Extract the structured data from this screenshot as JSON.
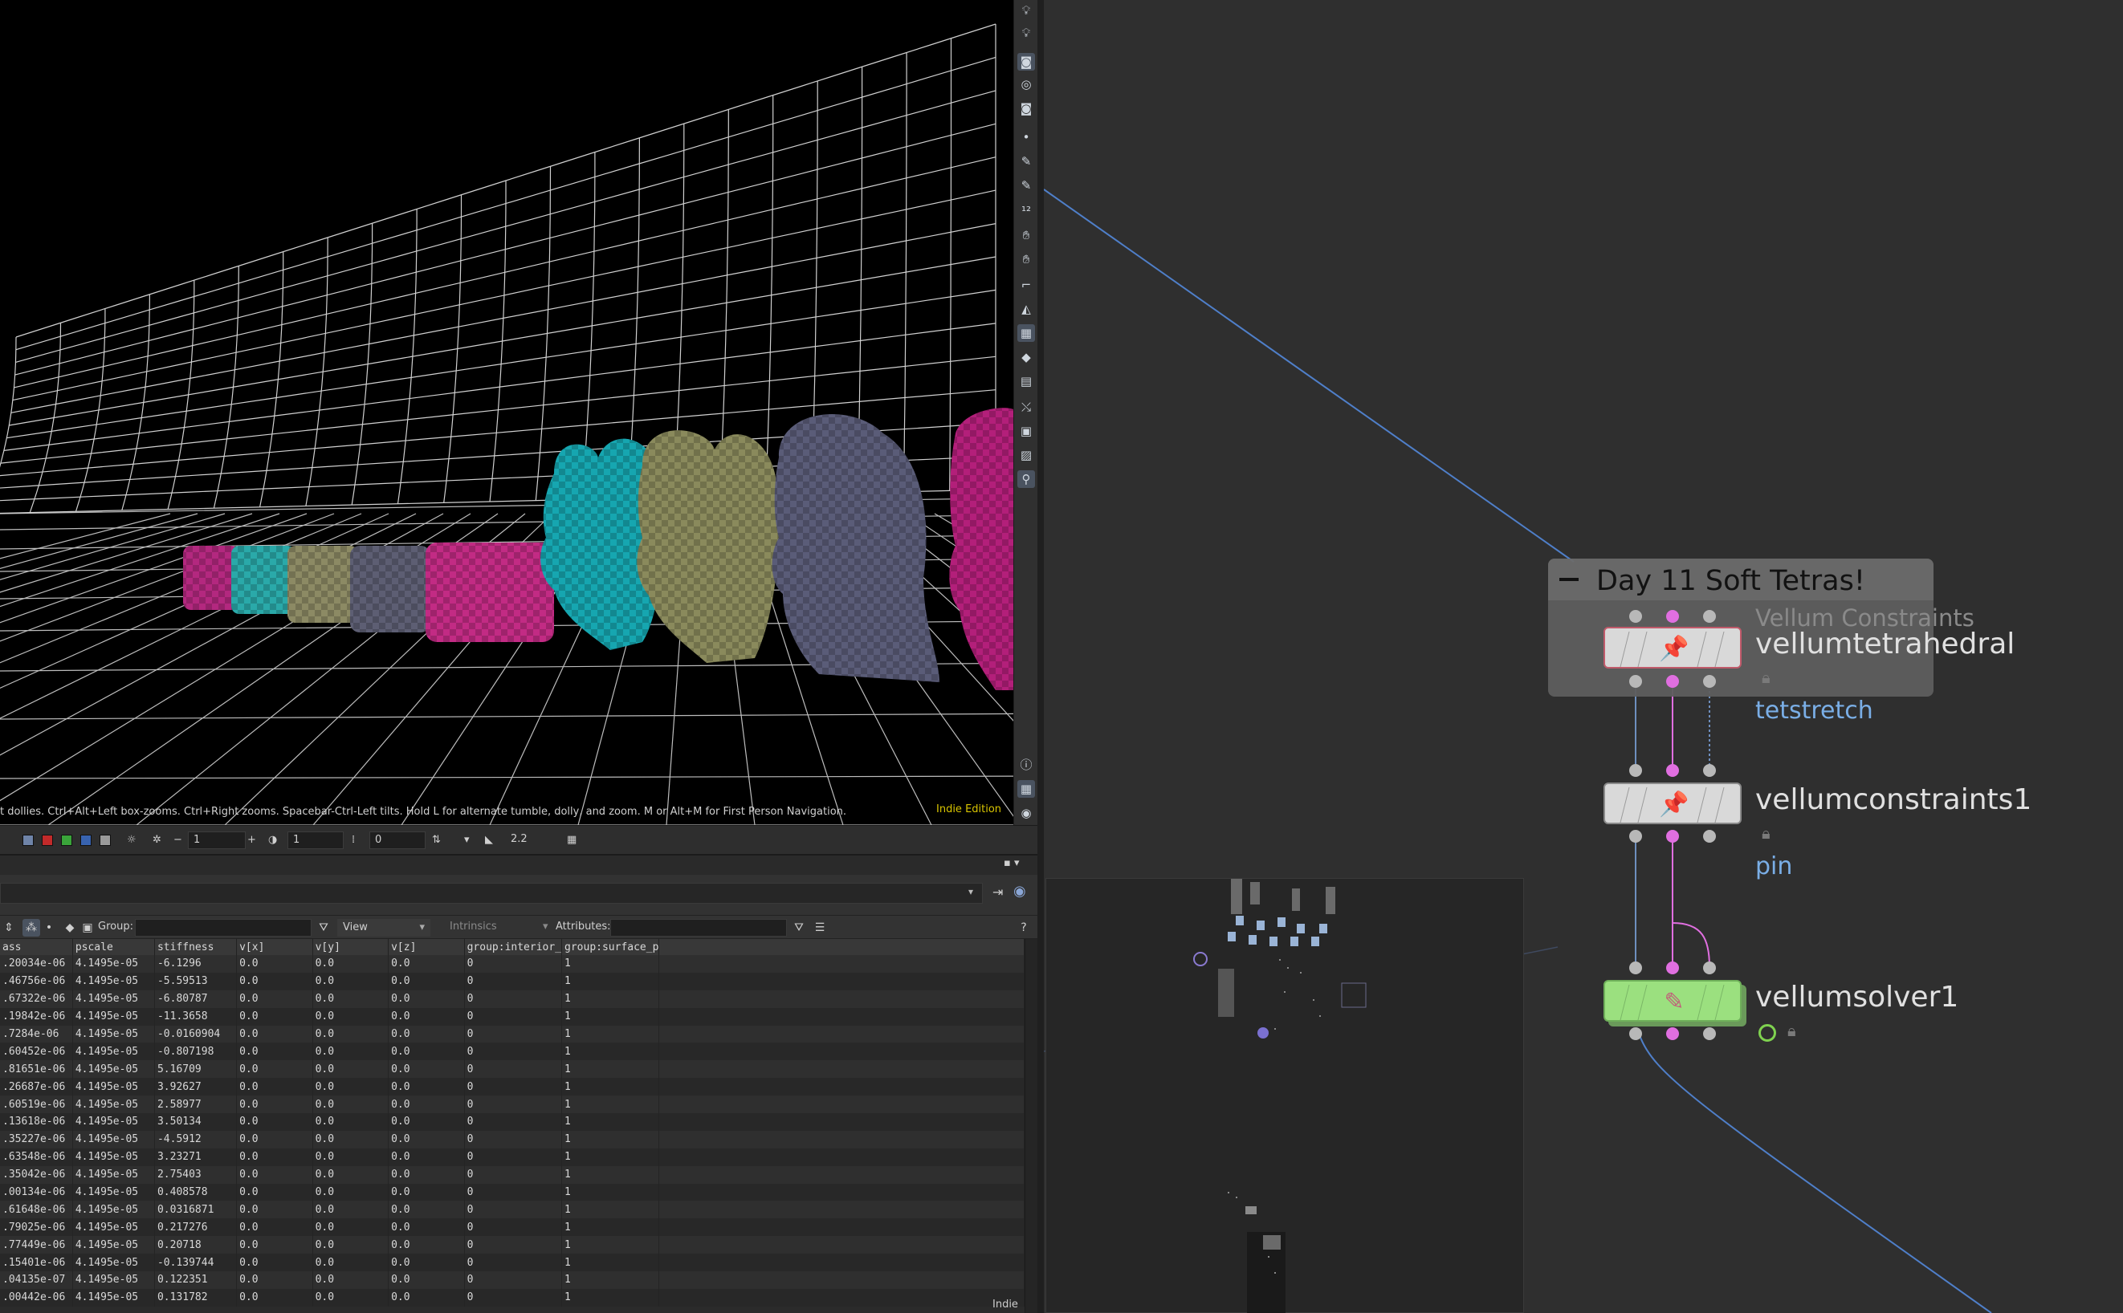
{
  "viewport": {
    "help_text": "t dollies. Ctrl+Alt+Left box-zooms. Ctrl+Right zooms. Spacebar-Ctrl-Left tilts. Hold L for alternate tumble, dolly, and zoom.    M or Alt+M for First Person Navigation.",
    "edition": "Indie Edition",
    "toolbar_icons": [
      "light-bulb-icon",
      "light-bulb-icon",
      "camera-icon",
      "eye-icon",
      "camera-icon",
      "point-icon",
      "brush-icon",
      "brush-icon",
      "number-icon",
      "hand-icon",
      "hand-icon",
      "corner-icon",
      "gradient-icon",
      "checker-icon",
      "shade-icon",
      "grid-icon",
      "select-icon",
      "square-icon",
      "image-icon",
      "pin-icon"
    ],
    "bottom_toolbar": {
      "field_1": "1",
      "field_2": "1",
      "field_3": "0",
      "field_4": "2.2"
    }
  },
  "spreadsheet": {
    "toolbar": {
      "group_label": "Group:",
      "view_label": "View",
      "intrinsics_label": "Intrinsics",
      "attributes_label": "Attributes:"
    },
    "columns": [
      "ass",
      "pscale",
      "stiffness",
      "v[x]",
      "v[y]",
      "v[z]",
      "group:interior_",
      "group:surface_p"
    ],
    "rows": [
      [
        ".20034e-06",
        "4.1495e-05",
        "-6.1296",
        "0.0",
        "0.0",
        "0.0",
        "0",
        "1"
      ],
      [
        ".46756e-06",
        "4.1495e-05",
        "-5.59513",
        "0.0",
        "0.0",
        "0.0",
        "0",
        "1"
      ],
      [
        ".67322e-06",
        "4.1495e-05",
        "-6.80787",
        "0.0",
        "0.0",
        "0.0",
        "0",
        "1"
      ],
      [
        ".19842e-06",
        "4.1495e-05",
        "-11.3658",
        "0.0",
        "0.0",
        "0.0",
        "0",
        "1"
      ],
      [
        ".7284e-06",
        "4.1495e-05",
        "-0.0160904",
        "0.0",
        "0.0",
        "0.0",
        "0",
        "1"
      ],
      [
        ".60452e-06",
        "4.1495e-05",
        "-0.807198",
        "0.0",
        "0.0",
        "0.0",
        "0",
        "1"
      ],
      [
        ".81651e-06",
        "4.1495e-05",
        "5.16709",
        "0.0",
        "0.0",
        "0.0",
        "0",
        "1"
      ],
      [
        ".26687e-06",
        "4.1495e-05",
        "3.92627",
        "0.0",
        "0.0",
        "0.0",
        "0",
        "1"
      ],
      [
        ".60519e-06",
        "4.1495e-05",
        "2.58977",
        "0.0",
        "0.0",
        "0.0",
        "0",
        "1"
      ],
      [
        ".13618e-06",
        "4.1495e-05",
        "3.50134",
        "0.0",
        "0.0",
        "0.0",
        "0",
        "1"
      ],
      [
        ".35227e-06",
        "4.1495e-05",
        "-4.5912",
        "0.0",
        "0.0",
        "0.0",
        "0",
        "1"
      ],
      [
        ".63548e-06",
        "4.1495e-05",
        "3.23271",
        "0.0",
        "0.0",
        "0.0",
        "0",
        "1"
      ],
      [
        ".35042e-06",
        "4.1495e-05",
        "2.75403",
        "0.0",
        "0.0",
        "0.0",
        "0",
        "1"
      ],
      [
        ".00134e-06",
        "4.1495e-05",
        "0.408578",
        "0.0",
        "0.0",
        "0.0",
        "0",
        "1"
      ],
      [
        ".61648e-06",
        "4.1495e-05",
        "0.0316871",
        "0.0",
        "0.0",
        "0.0",
        "0",
        "1"
      ],
      [
        ".79025e-06",
        "4.1495e-05",
        "0.217276",
        "0.0",
        "0.0",
        "0.0",
        "0",
        "1"
      ],
      [
        ".77449e-06",
        "4.1495e-05",
        "0.20718",
        "0.0",
        "0.0",
        "0.0",
        "0",
        "1"
      ],
      [
        ".15401e-06",
        "4.1495e-05",
        "-0.139744",
        "0.0",
        "0.0",
        "0.0",
        "0",
        "1"
      ],
      [
        ".04135e-07",
        "4.1495e-05",
        "0.122351",
        "0.0",
        "0.0",
        "0.0",
        "0",
        "1"
      ],
      [
        ".00442e-06",
        "4.1495e-05",
        "0.131782",
        "0.0",
        "0.0",
        "0.0",
        "0",
        "1"
      ]
    ],
    "edition": "Indie"
  },
  "network": {
    "network_box": {
      "title": "Day 11 Soft Tetras!",
      "subtitle": "Vellum Constraints"
    },
    "nodes": [
      {
        "name": "vellumtetrahedral",
        "sub": "tetstretch"
      },
      {
        "name": "vellumconstraints1",
        "sub": "pin"
      },
      {
        "name": "vellumsolver1",
        "sub": ""
      }
    ],
    "colors": {
      "node_default": "#d9d9d9",
      "node_solver": "#9be07f",
      "pink_wire": "#e06fe0",
      "blue_wire": "#4f7fc9",
      "sub_label": "#7aaee6"
    }
  }
}
